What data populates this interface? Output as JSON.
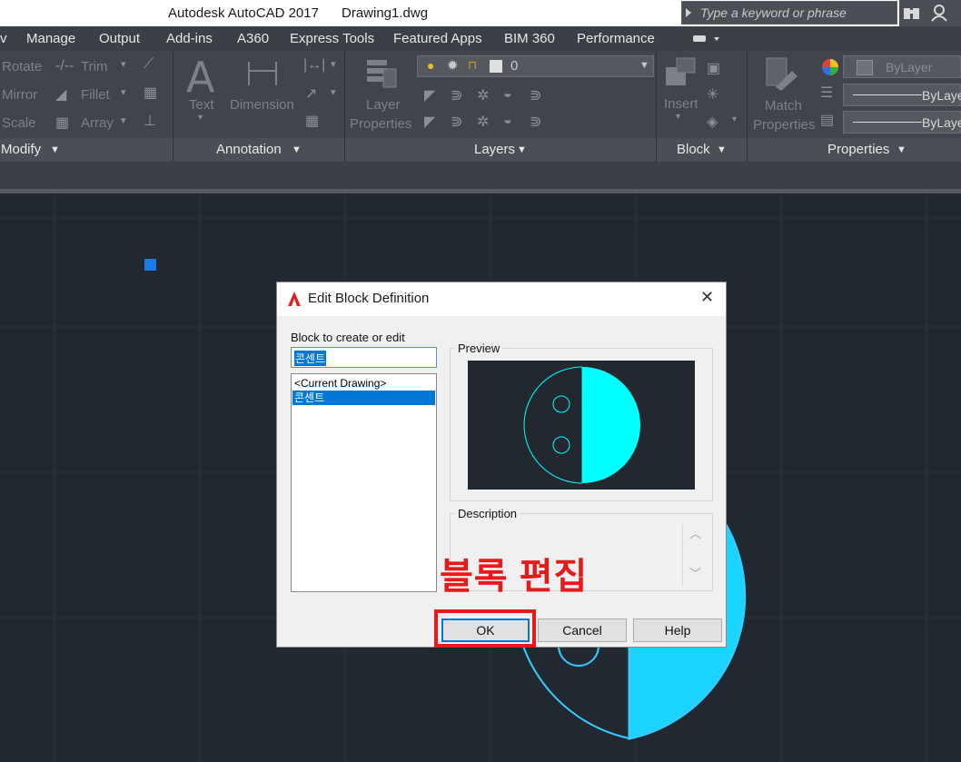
{
  "titlebar": {
    "app_title": "Autodesk AutoCAD 2017",
    "file_name": "Drawing1.dwg",
    "search_placeholder": "Type a keyword or phrase"
  },
  "menu_tabs": [
    {
      "label": "Manage"
    },
    {
      "label": "Output"
    },
    {
      "label": "Add-ins"
    },
    {
      "label": "A360"
    },
    {
      "label": "Express Tools"
    },
    {
      "label": "Featured Apps"
    },
    {
      "label": "BIM 360"
    },
    {
      "label": "Performance"
    }
  ],
  "ribbon": {
    "modify": {
      "footer": "Modify",
      "rotate": "Rotate",
      "trim": "Trim",
      "mirror": "Mirror",
      "fillet": "Fillet",
      "scale": "Scale",
      "array": "Array"
    },
    "annotation": {
      "footer": "Annotation",
      "text": "Text",
      "dimension": "Dimension"
    },
    "layers": {
      "footer": "Layers",
      "layer_properties_line1": "Layer",
      "layer_properties_line2": "Properties",
      "current_layer": "0"
    },
    "block": {
      "footer": "Block",
      "insert": "Insert"
    },
    "properties": {
      "footer": "Properties",
      "match_line1": "Match",
      "match_line2": "Properties",
      "color": "ByLayer",
      "linetype": "ByLayer",
      "lineweight": "ByLayer"
    }
  },
  "dialog": {
    "title": "Edit Block Definition",
    "block_label": "Block to create or edit",
    "block_name_value": "콘센트",
    "list_items": [
      {
        "label": "<Current Drawing>",
        "selected": false
      },
      {
        "label": "콘센트",
        "selected": true
      }
    ],
    "preview_label": "Preview",
    "description_label": "Description",
    "ok_label": "OK",
    "cancel_label": "Cancel",
    "help_label": "Help"
  },
  "annotation_overlay": {
    "text": "블록 편집",
    "color": "#e51a1a"
  },
  "colors": {
    "canvas_bg": "#212830",
    "accent_cyan": "#00ffff",
    "selection_blue": "#0078d7"
  }
}
